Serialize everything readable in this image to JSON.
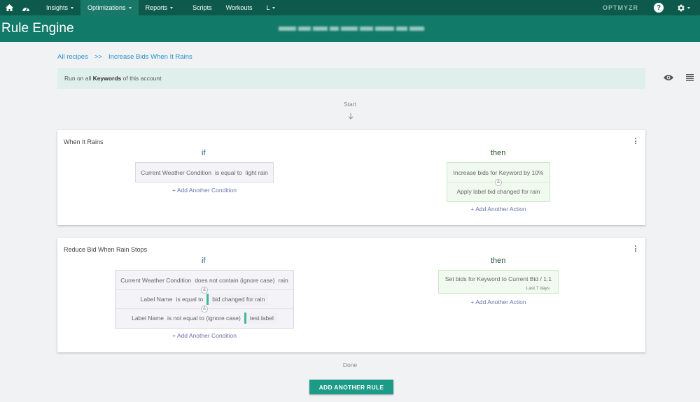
{
  "nav": {
    "items": [
      {
        "label": "Insights",
        "caret": true
      },
      {
        "label": "Optimizations",
        "caret": true,
        "active": true
      },
      {
        "label": "Reports",
        "caret": true
      },
      {
        "label": "Scripts",
        "caret": false
      },
      {
        "label": "Workouts",
        "caret": false
      },
      {
        "label": "L",
        "caret": true
      }
    ],
    "brand": "OPTMYZR",
    "help": "?"
  },
  "header": {
    "title": "Rule Engine"
  },
  "breadcrumb": {
    "root": "All recipes",
    "separator": ">>",
    "current": "Increase Bids When It Rains"
  },
  "run_on": {
    "prefix": "Run on all ",
    "entity": "Keywords",
    "suffix": " of this account"
  },
  "flow": {
    "start": "Start",
    "done": "Done"
  },
  "rules": [
    {
      "title": "When It Rains",
      "if_label": "if",
      "then_label": "then",
      "conditions": [
        {
          "field": "Current Weather Condition",
          "operator": "is equal to",
          "value": "light rain"
        }
      ],
      "actions": [
        {
          "text": "Increase bids for Keyword by 10%"
        },
        {
          "text": "Apply label bid changed for rain"
        }
      ],
      "add_condition": "+ Add Another Condition",
      "add_action": "+ Add Another Action"
    },
    {
      "title": "Reduce Bid When Rain Stops",
      "if_label": "if",
      "then_label": "then",
      "conditions": [
        {
          "field": "Current Weather Condition",
          "operator": "does not contain (ignore case)",
          "value": "rain"
        },
        {
          "field": "Label Name",
          "operator": "is equal to",
          "value": "bid changed for rain"
        },
        {
          "field": "Label Name",
          "operator": "is not equal to (ignore case)",
          "value": "test label"
        }
      ],
      "actions": [
        {
          "text": "Set bids for Keyword to Current Bid / 1.1",
          "sub": "Last 7 days"
        }
      ],
      "add_condition": "+ Add Another Condition",
      "add_action": "+ Add Another Action"
    }
  ],
  "and_symbol": "&",
  "add_rule_button": "ADD ANOTHER RULE",
  "colors": {
    "nav": "#0d5a4c",
    "header": "#127a69",
    "accent": "#1c9b86",
    "link": "#2a8ec9"
  }
}
